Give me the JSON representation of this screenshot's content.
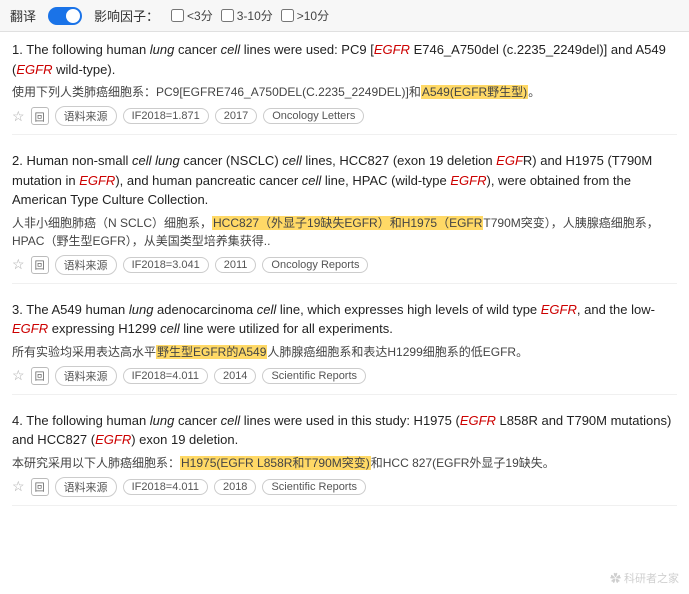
{
  "topbar": {
    "translate_label": "翻译",
    "filter_label": "影响因子：",
    "filters": [
      {
        "label": "<3分",
        "value": "lt3"
      },
      {
        "label": "3-10分",
        "value": "3to10"
      },
      {
        "label": ">10分",
        "value": "gt10"
      }
    ]
  },
  "results": [
    {
      "number": "1.",
      "en_parts": [
        {
          "text": "The following human "
        },
        {
          "text": "lung",
          "italic": true
        },
        {
          "text": " cancer "
        },
        {
          "text": "cell",
          "italic": true
        },
        {
          "text": " lines were used: PC9 ["
        },
        {
          "text": "EGFR",
          "italic": true,
          "red": true
        },
        {
          "text": " E746_A750del (c.2235_2249del)] and A549 ("
        },
        {
          "text": "EGFR",
          "italic": true,
          "red": true
        },
        {
          "text": " wild-type)."
        }
      ],
      "cn_parts": [
        {
          "text": "使用下列人类肺癌细胞系：PC9[EGFRE746_A750DEL(C.2235_2249DEL)]和"
        },
        {
          "text": "A549(EGFR野生型)",
          "highlight": true
        },
        {
          "text": "。"
        }
      ],
      "tags": [
        "IF2018=1.871",
        "2017",
        "Oncology Letters"
      ]
    },
    {
      "number": "2.",
      "en_parts": [
        {
          "text": "Human non-small "
        },
        {
          "text": "cell",
          "italic": true
        },
        {
          "text": " "
        },
        {
          "text": "lung",
          "italic": true
        },
        {
          "text": " cancer (NSCLC) "
        },
        {
          "text": "cell",
          "italic": true
        },
        {
          "text": " lines, HCC827 (exon 19 deletion "
        },
        {
          "text": "EGF",
          "italic": true,
          "red": true
        },
        {
          "text": "R) and H1975 (T790M mutation in "
        },
        {
          "text": "EGFR",
          "italic": true,
          "red": true
        },
        {
          "text": "), and human pancreatic cancer "
        },
        {
          "text": "cell",
          "italic": true
        },
        {
          "text": " line, HPAC (wild-type "
        },
        {
          "text": "EGFR",
          "italic": true,
          "red": true
        },
        {
          "text": "), were obtained from the American Type Culture Collection."
        }
      ],
      "cn_parts": [
        {
          "text": "人非小细胞肺癌（N SCLC）细胞系，"
        },
        {
          "text": "HCC827（外显子19缺失EGFR）和H1975（EGFR",
          "highlight": true
        },
        {
          "text": "T790M突变），人胰腺癌细胞系，HPAC（野生型EGFR），从美国类型培养集获得.."
        }
      ],
      "tags": [
        "IF2018=3.041",
        "2011",
        "Oncology Reports"
      ]
    },
    {
      "number": "3.",
      "en_parts": [
        {
          "text": "The A549 human "
        },
        {
          "text": "lung",
          "italic": true
        },
        {
          "text": " adenocarcinoma "
        },
        {
          "text": "cell",
          "italic": true
        },
        {
          "text": " line, which expresses high levels of wild type "
        },
        {
          "text": "EGFR",
          "italic": true,
          "red": true
        },
        {
          "text": ", and the low-"
        },
        {
          "text": "EGFR",
          "italic": true,
          "red": true
        },
        {
          "text": " expressing H1299 "
        },
        {
          "text": "cell",
          "italic": true
        },
        {
          "text": " line were utilized for all experiments."
        }
      ],
      "cn_parts": [
        {
          "text": "所有实验均采用表达高水平"
        },
        {
          "text": "野生型EGFR的A549",
          "highlight": true
        },
        {
          "text": "人肺腺癌细胞系和表达H1299细胞系的低EGFR。"
        }
      ],
      "tags": [
        "IF2018=4.011",
        "2014",
        "Scientific Reports"
      ]
    },
    {
      "number": "4.",
      "en_parts": [
        {
          "text": "The following human "
        },
        {
          "text": "lung",
          "italic": true
        },
        {
          "text": " cancer "
        },
        {
          "text": "cell",
          "italic": true
        },
        {
          "text": " lines were used in this study: H1975 ("
        },
        {
          "text": "EGFR",
          "italic": true,
          "red": true
        },
        {
          "text": " L858R and T790M mutations) and HCC827 ("
        },
        {
          "text": "EGFR",
          "italic": true,
          "red": true
        },
        {
          "text": ") exon 19 deletion."
        }
      ],
      "cn_parts": [
        {
          "text": "本研究采用以下人肺癌细胞系："
        },
        {
          "text": "H1975(EGFR L858R和T790M突变)",
          "highlight": true
        },
        {
          "text": "和HCC 827(EGFR外显子19缺失。"
        }
      ],
      "tags": [
        "IF2018=4.011",
        "2018",
        "Scientific Reports"
      ]
    }
  ],
  "watermark": "科研者之家"
}
